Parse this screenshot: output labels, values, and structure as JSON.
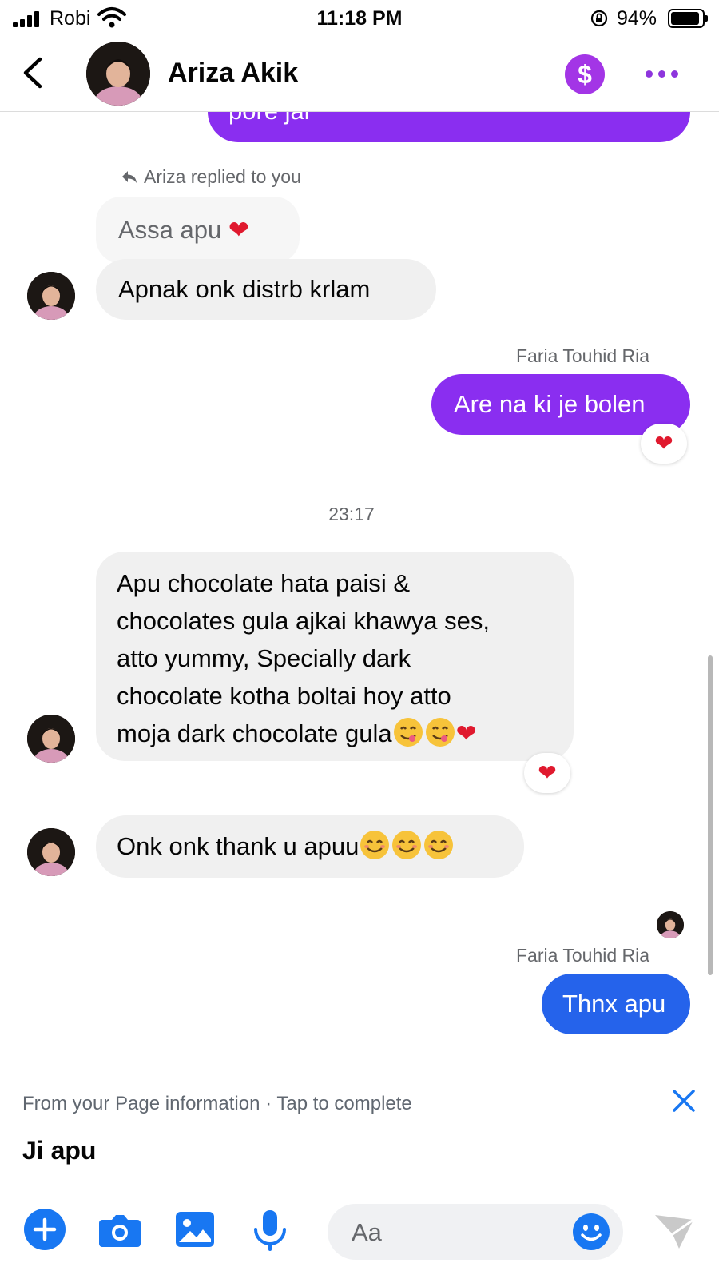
{
  "status_bar": {
    "carrier": "Robi",
    "time": "11:18 PM",
    "battery_percent": "94%",
    "battery_level": 0.94
  },
  "header": {
    "contact_name": "Ariza Akik",
    "pay_symbol": "$"
  },
  "chat": {
    "partial_message": "pore jai",
    "reply_notice": "Ariza replied to you",
    "reply_quote": "Assa apu",
    "message_1": "Apnak onk distrb krlam",
    "sender_name_1": "Faria Touhid Ria",
    "message_2": "Are na ki je bolen",
    "timestamp": "23:17",
    "message_3_lines": [
      "Apu chocolate hata paisi &",
      "chocolates gula ajkai khawya ses,",
      "atto yummy, Specially dark",
      "chocolate kotha boltai hoy atto",
      "moja dark chocolate gula"
    ],
    "message_4": "Onk onk thank u apuu",
    "sender_name_2": "Faria Touhid Ria",
    "message_5": "Thnx apu"
  },
  "composer": {
    "info_text": "From your Page information · Tap to complete",
    "draft_reply": "Ji apu",
    "input_placeholder": "Aa"
  },
  "colors": {
    "accent_purple": "#8a2ef0",
    "accent_blue": "#2563eb",
    "icon_blue": "#1877f2",
    "incoming_bubble": "#f0f0f0",
    "reaction_heart": "#e0192e"
  }
}
